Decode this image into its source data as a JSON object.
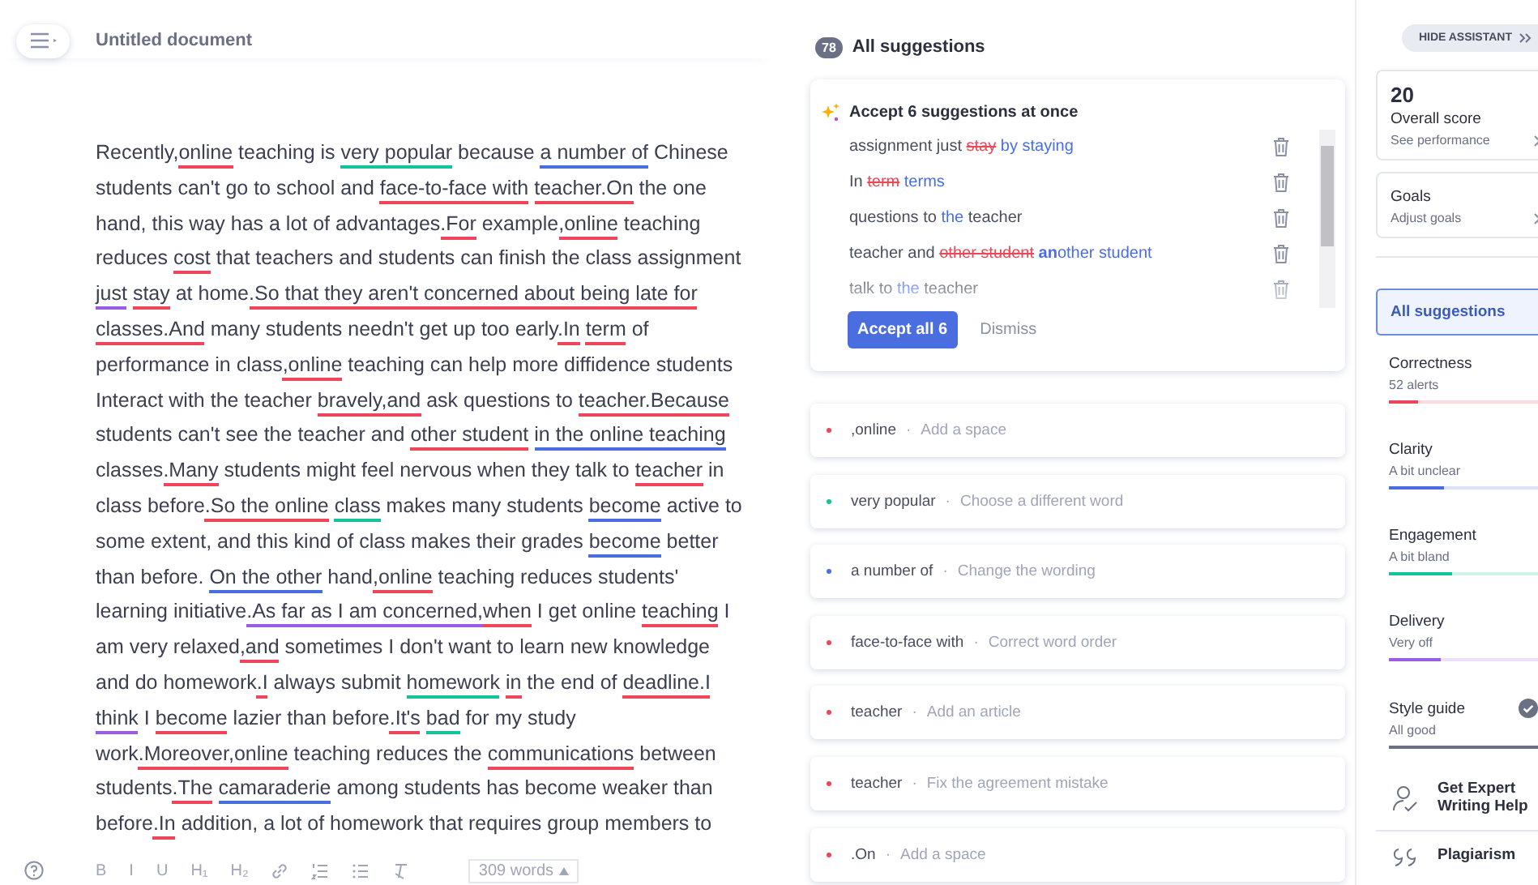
{
  "document": {
    "title": "Untitled document"
  },
  "essay": {
    "lines": [
      [
        {
          "text": "Recently,"
        },
        {
          "text": "online",
          "color": "#f0465a"
        },
        {
          "text": " teaching is "
        },
        {
          "text": "very popular",
          "color": "#15c39a"
        },
        {
          "text": " because "
        },
        {
          "text": "a number of",
          "color": "#4a6ee0"
        },
        {
          "text": " Chinese"
        }
      ],
      [
        {
          "text": "students can't go to school and "
        },
        {
          "text": "face-to-face with",
          "color": "#f0465a"
        },
        {
          "text": " teacher.On",
          "color": "#f0465a"
        },
        {
          "text": " the one"
        }
      ],
      [
        {
          "text": "hand, this way has a lot of advantages"
        },
        {
          "text": ".For",
          "color": "#f0465a"
        },
        {
          "text": " example"
        },
        {
          "text": ",online",
          "color": "#f0465a"
        },
        {
          "text": " teaching"
        }
      ],
      [
        {
          "text": "reduces "
        },
        {
          "text": "cost",
          "color": "#f0465a"
        },
        {
          "text": " that teachers and students can finish the class assignment"
        }
      ],
      [
        {
          "text": "just",
          "color": "#9b5de5"
        },
        {
          "text": " stay",
          "color": "#f0465a"
        },
        {
          "text": " at home"
        },
        {
          "text": ".So that they aren't concerned about being late for",
          "color": "#f0465a"
        }
      ],
      [
        {
          "text": "classes.And",
          "color": "#f0465a"
        },
        {
          "text": " many students needn't get up too early"
        },
        {
          "text": ".In",
          "color": "#f0465a"
        },
        {
          "text": " term",
          "color": "#f0465a"
        },
        {
          "text": " of"
        }
      ],
      [
        {
          "text": "performance in class"
        },
        {
          "text": ",online",
          "color": "#f0465a"
        },
        {
          "text": " teaching can help more diffidence students"
        }
      ],
      [
        {
          "text": "Interact with the teacher "
        },
        {
          "text": "bravely,and",
          "color": "#f0465a"
        },
        {
          "text": " ask questions to "
        },
        {
          "text": "teacher.Because",
          "color": "#f0465a"
        }
      ],
      [
        {
          "text": "students can't see the teacher and "
        },
        {
          "text": "other student",
          "color": "#f0465a"
        },
        {
          "text": " in the online teaching",
          "color": "#4a6ee0"
        }
      ],
      [
        {
          "text": "classes"
        },
        {
          "text": ".Many",
          "color": "#f0465a"
        },
        {
          "text": " students might feel nervous when they talk to "
        },
        {
          "text": "teacher",
          "color": "#f0465a"
        },
        {
          "text": " in"
        }
      ],
      [
        {
          "text": "class before"
        },
        {
          "text": ".So the online",
          "color": "#f0465a"
        },
        {
          "text": " class",
          "color": "#15c39a"
        },
        {
          "text": " makes many students "
        },
        {
          "text": "become",
          "color": "#4a6ee0"
        },
        {
          "text": " active to"
        }
      ],
      [
        {
          "text": "some extent, and this kind of class makes their grades "
        },
        {
          "text": "become",
          "color": "#4a6ee0"
        },
        {
          "text": " better"
        }
      ],
      [
        {
          "text": "than before. "
        },
        {
          "text": "On the other",
          "color": "#4a6ee0"
        },
        {
          "text": " hand"
        },
        {
          "text": ",online",
          "color": "#f0465a"
        },
        {
          "text": " teaching reduces students'"
        }
      ],
      [
        {
          "text": "learning initiative"
        },
        {
          "text": ".As far as I am concerned,",
          "color": "#9b5de5"
        },
        {
          "text": "when",
          "color": "#f0465a"
        },
        {
          "text": " I get online "
        },
        {
          "text": "teaching",
          "color": "#f0465a"
        },
        {
          "text": " I"
        }
      ],
      [
        {
          "text": "am very relaxed"
        },
        {
          "text": ",and",
          "color": "#f0465a"
        },
        {
          "text": " sometimes I don't want to learn new knowledge"
        }
      ],
      [
        {
          "text": "and do homework"
        },
        {
          "text": ".I",
          "color": "#f0465a"
        },
        {
          "text": " always submit "
        },
        {
          "text": "homework",
          "color": "#15c39a"
        },
        {
          "text": " in",
          "color": "#f0465a"
        },
        {
          "text": " the end of "
        },
        {
          "text": "deadline.I",
          "color": "#f0465a"
        }
      ],
      [
        {
          "text": "think",
          "color": "#9b5de5"
        },
        {
          "text": " I "
        },
        {
          "text": "become",
          "color": "#f0465a"
        },
        {
          "text": " lazier than before"
        },
        {
          "text": ".It's",
          "color": "#f0465a"
        },
        {
          "text": " bad",
          "color": "#15c39a"
        },
        {
          "text": " for my study"
        }
      ],
      [
        {
          "text": "work"
        },
        {
          "text": ".Moreover,online",
          "color": "#f0465a"
        },
        {
          "text": " teaching reduces the "
        },
        {
          "text": "communications",
          "color": "#f0465a"
        },
        {
          "text": " between"
        }
      ],
      [
        {
          "text": "students"
        },
        {
          "text": ".The",
          "color": "#f0465a"
        },
        {
          "text": " camaraderie",
          "color": "#4a6ee0"
        },
        {
          "text": " among students has become weaker than"
        }
      ],
      [
        {
          "text": "before"
        },
        {
          "text": ".In",
          "color": "#f0465a"
        },
        {
          "text": " addition, a lot of homework that requires group members to"
        }
      ]
    ]
  },
  "toolbar": {
    "buttons": [
      {
        "kind": "text",
        "label": "B"
      },
      {
        "kind": "text",
        "label": "I"
      },
      {
        "kind": "text",
        "label": "U"
      },
      {
        "kind": "text",
        "label": "H₁"
      },
      {
        "kind": "text",
        "label": "H₂"
      },
      {
        "kind": "link"
      },
      {
        "kind": "ordered-list"
      },
      {
        "kind": "bullet-list"
      },
      {
        "kind": "clear-format"
      }
    ],
    "word_count": "309 words"
  },
  "suggestions_header": {
    "count": "78",
    "title": "All suggestions"
  },
  "accept_card": {
    "title": "Accept 6 suggestions at once",
    "items": [
      [
        {
          "kind": "plain",
          "text": "assignment just "
        },
        {
          "kind": "removed",
          "text": "stay"
        },
        {
          "kind": "added",
          "text": " by staying"
        }
      ],
      [
        {
          "kind": "plain",
          "text": "In "
        },
        {
          "kind": "removed",
          "text": "term"
        },
        {
          "kind": "added",
          "text": " terms"
        }
      ],
      [
        {
          "kind": "plain",
          "text": "questions to "
        },
        {
          "kind": "added",
          "text": "the"
        },
        {
          "kind": "plain",
          "text": " teacher"
        }
      ],
      [
        {
          "kind": "plain",
          "text": "teacher and "
        },
        {
          "kind": "removed",
          "text": "other student"
        },
        {
          "kind": "added",
          "text": " **an**other student"
        }
      ],
      [
        {
          "kind": "plain",
          "text": "talk to "
        },
        {
          "kind": "added",
          "text": "the"
        },
        {
          "kind": "plain",
          "text": " teacher"
        }
      ]
    ],
    "accept_button": "Accept all 6",
    "dismiss_button": "Dismiss"
  },
  "suggestion_cards": [
    {
      "color": "#f0465a",
      "word": ",online",
      "separator": "·",
      "hint": "Add a space"
    },
    {
      "color": "#15c39a",
      "word": "very popular",
      "separator": "·",
      "hint": "Choose a different word"
    },
    {
      "color": "#4a6ee0",
      "word": "a number of",
      "separator": "·",
      "hint": "Change the wording"
    },
    {
      "color": "#f0465a",
      "word": "face-to-face with",
      "separator": "·",
      "hint": "Correct word order"
    },
    {
      "color": "#f0465a",
      "word": "teacher",
      "separator": "·",
      "hint": "Add an article"
    },
    {
      "color": "#f0465a",
      "word": "teacher",
      "separator": "·",
      "hint": "Fix the agreement mistake"
    },
    {
      "color": "#f0465a",
      "word": ".On",
      "separator": "·",
      "hint": "Add a space"
    }
  ],
  "assistant": {
    "hide_button": "HIDE ASSISTANT",
    "score": {
      "value": "20",
      "label": "Overall score",
      "link": "See performance"
    },
    "goals": {
      "label": "Goals",
      "link": "Adjust goals"
    },
    "filters": [
      {
        "label": "All suggestions",
        "selected": true
      }
    ],
    "categories": [
      {
        "name": "Correctness",
        "status": "52 alerts",
        "level": 0.2,
        "color": "#f0465a",
        "checked": false
      },
      {
        "name": "Clarity",
        "status": "A bit unclear",
        "level": 0.37,
        "color": "#4a6ee0",
        "checked": false
      },
      {
        "name": "Engagement",
        "status": "A bit bland",
        "level": 0.42,
        "color": "#15c39a",
        "checked": false
      },
      {
        "name": "Delivery",
        "status": "Very off",
        "level": 0.35,
        "color": "#9b5de5",
        "checked": false
      },
      {
        "name": "Style guide",
        "status": "All good",
        "level": 1,
        "color": "#6b7084",
        "checked": true
      }
    ],
    "expert": "Get Expert Writing Help",
    "plagiarism": "Plagiarism"
  }
}
